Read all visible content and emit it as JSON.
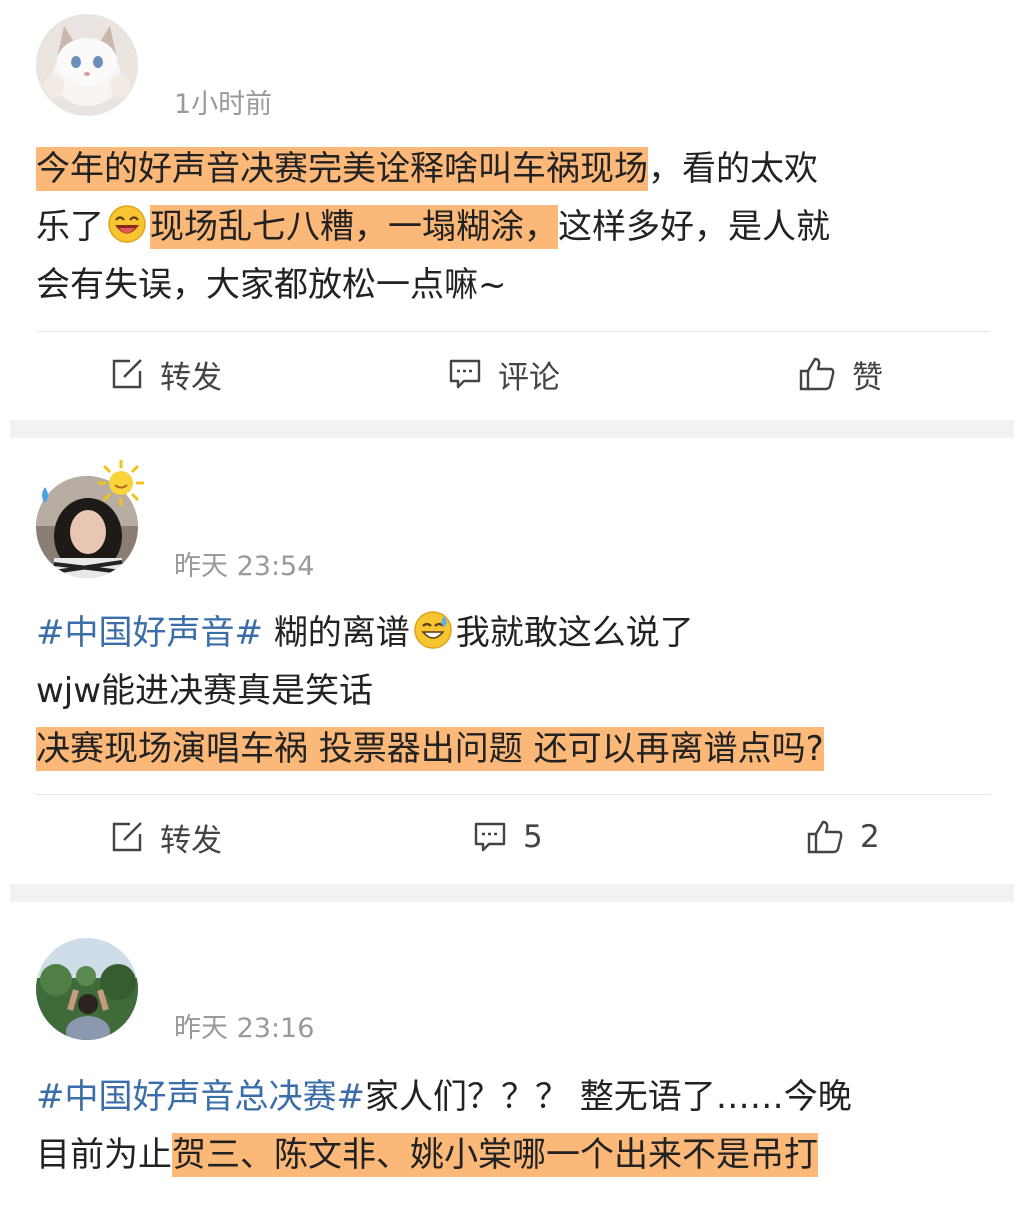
{
  "posts": [
    {
      "time": "1小时前",
      "lines": [
        [
          {
            "t": "今年的好声音决赛完美诠释啥叫车祸现场",
            "s": "hl"
          },
          {
            "t": "，看的太欢"
          }
        ],
        [
          {
            "t": "乐了"
          },
          {
            "emoji": "laughing-face-icon"
          },
          {
            "t": "现场乱七八糟，一塌糊涂，",
            "s": "hl"
          },
          {
            "t": "这样多好，是人就"
          }
        ],
        [
          {
            "t": "会有失误，大家都放松一点嘛~"
          }
        ]
      ],
      "actions": {
        "repost": "转发",
        "comment": "评论",
        "like": "赞"
      }
    },
    {
      "time": "昨天 23:54",
      "lines": [
        [
          {
            "t": "#中国好声音#",
            "s": "tag"
          },
          {
            "t": " 糊的离谱"
          },
          {
            "emoji": "sweat-smile-icon"
          },
          {
            "t": "我就敢这么说了"
          }
        ],
        [
          {
            "t": "wjw能进决赛真是笑话"
          }
        ],
        [
          {
            "t": "决赛现场演唱车祸 投票器出问题 还可以再离谱点吗?",
            "s": "hl"
          }
        ]
      ],
      "actions": {
        "repost": "转发",
        "comment": "5",
        "like": "2"
      }
    },
    {
      "time": "昨天 23:16",
      "lines": [
        [
          {
            "t": "#中国好声音总决赛#",
            "s": "tag"
          },
          {
            "t": "家人们？？？ 整无语了……今晚"
          }
        ],
        [
          {
            "t": "目前为止"
          },
          {
            "t": "贺三、陈文非、姚小棠哪一个出来不是吊打",
            "s": "hl"
          }
        ]
      ]
    }
  ],
  "colors": {
    "highlight": "#fbb878",
    "tag": "#3b6ea8",
    "time": "#9a9a9a"
  }
}
